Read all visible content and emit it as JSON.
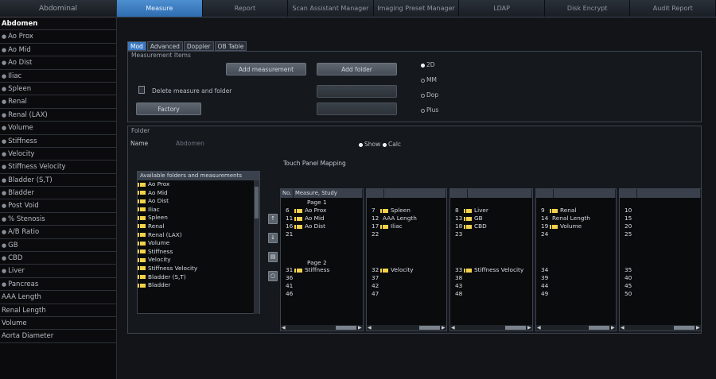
{
  "sidebar": {
    "title": "Abdominal",
    "header": "Abdomen",
    "items": [
      "Ao Prox",
      "Ao Mid",
      "Ao Dist",
      "Iliac",
      "Spleen",
      "Renal",
      "Renal (LAX)",
      "Volume",
      "Stiffness",
      "Velocity",
      "Stiffness Velocity",
      "Bladder (S,T)",
      "Bladder",
      "Post Void",
      "% Stenosis",
      "A/B Ratio",
      "GB",
      "CBD",
      "Liver",
      "Pancreas",
      "AAA Length",
      "Renal Length",
      "Volume",
      "Aorta Diameter"
    ]
  },
  "tabs": [
    "Measure",
    "Report",
    "Scan Assistant Manager",
    "Imaging Preset Manager",
    "LDAP",
    "Disk Encrypt",
    "Audit Report"
  ],
  "subtabs": [
    "Mod",
    "Advanced",
    "Doppler",
    "OB Table"
  ],
  "measurement_items": {
    "label": "Measurement Items",
    "add_measurement": "Add measurement",
    "add_folder": "Add folder",
    "delete_label": "Delete measure and folder",
    "factory": "Factory",
    "dim_button_1": "",
    "dim_button_2": "",
    "modes": [
      "2D",
      "MM",
      "Dop",
      "Plus"
    ]
  },
  "folder": {
    "label": "Folder",
    "name_label": "Name",
    "name_value": "Abdomen",
    "option_1": "Show",
    "option_2": "Calc"
  },
  "available": {
    "header": "Available folders and measurements",
    "items": [
      "Ao Prox",
      "Ao Mid",
      "Ao Dist",
      "Iliac",
      "Spleen",
      "Renal",
      "Renal (LAX)",
      "Volume",
      "Stiffness",
      "Velocity",
      "Stiffness Velocity",
      "Bladder (S,T)",
      "Bladder"
    ]
  },
  "side_buttons": [
    "↑",
    "↓",
    "▤",
    "○"
  ],
  "touch_panel": {
    "label": "Touch Panel Mapping",
    "col1_headers": [
      "No.",
      "Measure, Study"
    ],
    "page1": "Page 1",
    "page2": "Page 2",
    "col1": [
      {
        "n": "6",
        "t": "Ao Prox",
        "f": true
      },
      {
        "n": "11",
        "t": "Ao Mid",
        "f": true
      },
      {
        "n": "16",
        "t": "Ao Dist",
        "f": true
      },
      {
        "n": "21",
        "t": "",
        "f": false
      },
      {
        "n": "31",
        "t": "Stiffness",
        "f": true
      },
      {
        "n": "36",
        "t": "",
        "f": false
      },
      {
        "n": "41",
        "t": "",
        "f": false
      },
      {
        "n": "46",
        "t": "",
        "f": false
      }
    ],
    "col2": [
      {
        "n": "7",
        "t": "Spleen",
        "f": true
      },
      {
        "n": "12",
        "t": "AAA Length",
        "f": false
      },
      {
        "n": "17",
        "t": "Iliac",
        "f": true
      },
      {
        "n": "22",
        "t": "",
        "f": false
      },
      {
        "n": "32",
        "t": "Velocity",
        "f": true
      },
      {
        "n": "37",
        "t": "",
        "f": false
      },
      {
        "n": "42",
        "t": "",
        "f": false
      },
      {
        "n": "47",
        "t": "",
        "f": false
      }
    ],
    "col3": [
      {
        "n": "8",
        "t": "Liver",
        "f": true
      },
      {
        "n": "13",
        "t": "GB",
        "f": true
      },
      {
        "n": "18",
        "t": "CBD",
        "f": true
      },
      {
        "n": "23",
        "t": "",
        "f": false
      },
      {
        "n": "33",
        "t": "Stiffness Velocity",
        "f": true
      },
      {
        "n": "38",
        "t": "",
        "f": false
      },
      {
        "n": "43",
        "t": "",
        "f": false
      },
      {
        "n": "48",
        "t": "",
        "f": false
      }
    ],
    "col4": [
      {
        "n": "9",
        "t": "Renal",
        "f": true
      },
      {
        "n": "14",
        "t": "Renal Length",
        "f": false
      },
      {
        "n": "19",
        "t": "Volume",
        "f": true
      },
      {
        "n": "24",
        "t": "",
        "f": false
      },
      {
        "n": "34",
        "t": "",
        "f": false
      },
      {
        "n": "39",
        "t": "",
        "f": false
      },
      {
        "n": "44",
        "t": "",
        "f": false
      },
      {
        "n": "49",
        "t": "",
        "f": false
      }
    ],
    "col5": [
      {
        "n": "10",
        "t": "",
        "f": false
      },
      {
        "n": "15",
        "t": "",
        "f": false
      },
      {
        "n": "20",
        "t": "",
        "f": false
      },
      {
        "n": "25",
        "t": "",
        "f": false
      },
      {
        "n": "35",
        "t": "",
        "f": false
      },
      {
        "n": "40",
        "t": "",
        "f": false
      },
      {
        "n": "45",
        "t": "",
        "f": false
      },
      {
        "n": "50",
        "t": "",
        "f": false
      }
    ]
  }
}
